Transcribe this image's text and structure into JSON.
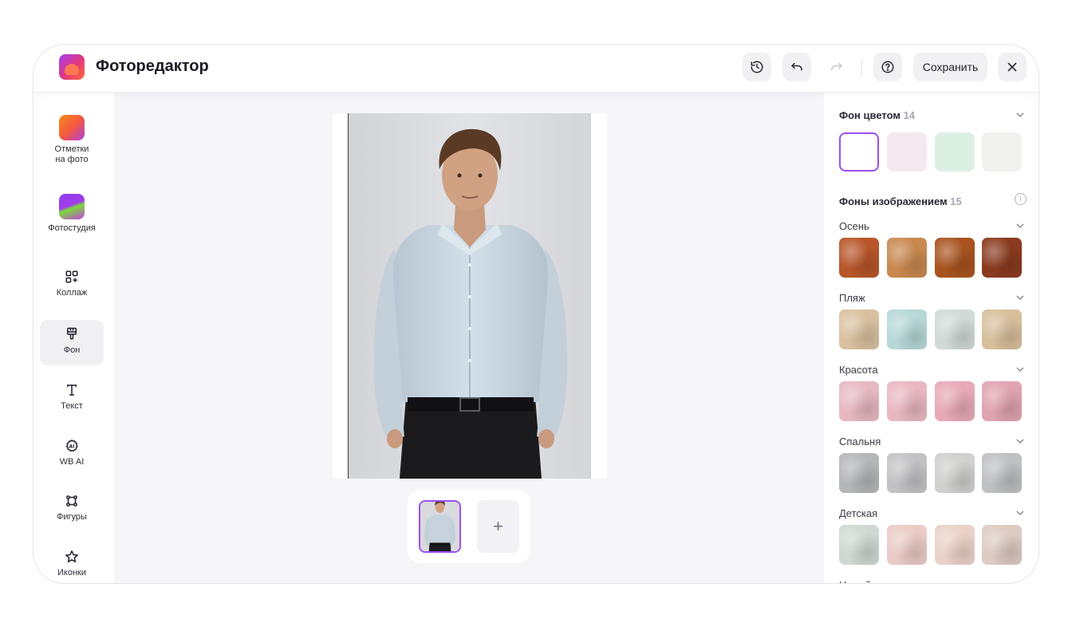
{
  "app": {
    "title": "Фоторедактор"
  },
  "header": {
    "save_label": "Сохранить",
    "icons": [
      "history-icon",
      "undo-icon",
      "redo-icon",
      "help-icon",
      "close-icon"
    ]
  },
  "sidebar": {
    "items": [
      {
        "label": "Отметки\nна фото",
        "icon": "marks-app-icon"
      },
      {
        "label": "Фотостудия",
        "icon": "photostudio-app-icon"
      },
      {
        "label": "Коллаж",
        "icon": "collage-icon"
      },
      {
        "label": "Фон",
        "icon": "paint-brush-icon",
        "active": true
      },
      {
        "label": "Текст",
        "icon": "text-icon"
      },
      {
        "label": "WB AI",
        "icon": "ai-icon"
      },
      {
        "label": "Фигуры",
        "icon": "shapes-icon"
      },
      {
        "label": "Иконки",
        "icon": "star-icon"
      }
    ]
  },
  "panel": {
    "color_bg": {
      "title": "Фон цветом",
      "count": "14",
      "swatches": [
        "#ffffff",
        "#f3e9ef",
        "#dcefe3",
        "#f1f1ef"
      ]
    },
    "image_bg": {
      "title": "Фоны изображением",
      "count": "15"
    },
    "categories": [
      {
        "name": "Осень",
        "colors": [
          "#b8562a",
          "#c9884f",
          "#a9541f",
          "#8a3b1f"
        ]
      },
      {
        "name": "Пляж",
        "colors": [
          "#d9c1a0",
          "#b7d8d7",
          "#d1dad6",
          "#d7bf9b"
        ]
      },
      {
        "name": "Красота",
        "colors": [
          "#e7b8c2",
          "#e9b7c2",
          "#e7a9b7",
          "#e0a3b1"
        ]
      },
      {
        "name": "Спальня",
        "colors": [
          "#b5b6b8",
          "#c2c2c4",
          "#d0d0cf",
          "#bfc0c2"
        ]
      },
      {
        "name": "Детская",
        "colors": [
          "#cfd8d2",
          "#eacbc6",
          "#ead2c8",
          "#ddcbc3"
        ]
      },
      {
        "name": "Новый год",
        "colors": []
      }
    ]
  },
  "colors": {
    "accent": "#9d4ef0"
  }
}
